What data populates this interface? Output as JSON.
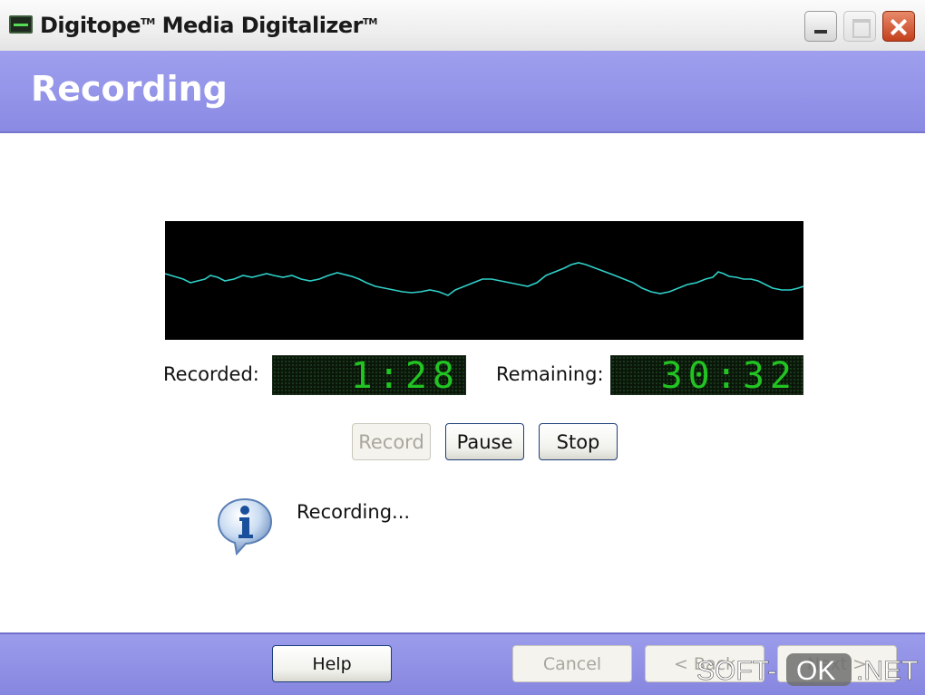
{
  "window": {
    "title": "Digitope",
    "title_tm1": "TM",
    "title_rest": " Media Digitalizer",
    "title_tm2": "TM"
  },
  "header": {
    "title": "Recording"
  },
  "counters": {
    "recorded_label": "Recorded:",
    "recorded_value": "1:28",
    "remaining_label": "Remaining:",
    "remaining_value": "30:32"
  },
  "controls": {
    "record_label": "Record",
    "pause_label": "Pause",
    "stop_label": "Stop"
  },
  "status": {
    "message": "Recording..."
  },
  "footer": {
    "help_label": "Help",
    "cancel_label": "Cancel",
    "back_label": "< Back",
    "next_label": "Next >"
  },
  "watermark": {
    "part1": "SOFT-",
    "part2": "OK",
    "part3": ".NET"
  },
  "icons": [
    "app-icon",
    "minimize-icon",
    "maximize-icon",
    "close-icon",
    "info-icon"
  ],
  "colors": {
    "header_band": "#8a8ae4",
    "lcd_digits": "#22c322",
    "waveform": "#2fd0c8"
  }
}
